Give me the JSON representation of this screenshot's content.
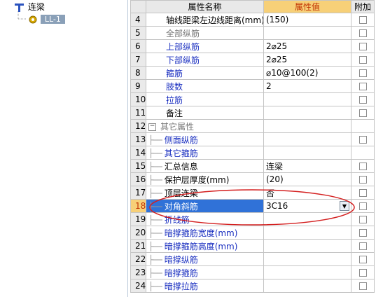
{
  "tree": {
    "root_label": "连梁",
    "child_label": "LL-1"
  },
  "grid": {
    "headers": {
      "name": "属性名称",
      "value": "属性值",
      "extra": "附加"
    },
    "rows": [
      {
        "num": "4",
        "name": "轴线距梁左边线距离(mm)",
        "value": "(150)",
        "style": "normal",
        "branch": false,
        "check": true
      },
      {
        "num": "5",
        "name": "全部纵筋",
        "value": "",
        "style": "gray",
        "branch": false,
        "check": true
      },
      {
        "num": "6",
        "name": "上部纵筋",
        "value": "2⌀25",
        "style": "blue",
        "branch": false,
        "check": true
      },
      {
        "num": "7",
        "name": "下部纵筋",
        "value": "2⌀25",
        "style": "blue",
        "branch": false,
        "check": true
      },
      {
        "num": "8",
        "name": "箍筋",
        "value": "⌀10@100(2)",
        "style": "blue",
        "branch": false,
        "check": true
      },
      {
        "num": "9",
        "name": "肢数",
        "value": "2",
        "style": "blue",
        "branch": false,
        "check": true
      },
      {
        "num": "10",
        "name": "拉筋",
        "value": "",
        "style": "blue",
        "branch": false,
        "check": true
      },
      {
        "num": "11",
        "name": "备注",
        "value": "",
        "style": "normal",
        "branch": false,
        "check": true
      },
      {
        "num": "12",
        "name": "其它属性",
        "value": "",
        "style": "group",
        "branch": false,
        "check": false
      },
      {
        "num": "13",
        "name": "侧面纵筋",
        "value": "",
        "style": "blue",
        "branch": true,
        "check": true
      },
      {
        "num": "14",
        "name": "其它箍筋",
        "value": "",
        "style": "blue",
        "branch": true,
        "check": false
      },
      {
        "num": "15",
        "name": "汇总信息",
        "value": "连梁",
        "style": "normal",
        "branch": true,
        "check": true
      },
      {
        "num": "16",
        "name": "保护层厚度(mm)",
        "value": "(20)",
        "style": "normal",
        "branch": true,
        "check": true
      },
      {
        "num": "17",
        "name": "顶层连梁",
        "value": "否",
        "style": "normal",
        "branch": true,
        "check": true
      },
      {
        "num": "18",
        "name": "对角斜筋",
        "value": "3C16",
        "style": "selected",
        "branch": true,
        "check": true
      },
      {
        "num": "19",
        "name": "折线筋",
        "value": "",
        "style": "blue",
        "branch": true,
        "check": true
      },
      {
        "num": "20",
        "name": "暗撑箍筋宽度(mm)",
        "value": "",
        "style": "blue",
        "branch": true,
        "check": true
      },
      {
        "num": "21",
        "name": "暗撑箍筋高度(mm)",
        "value": "",
        "style": "blue",
        "branch": true,
        "check": true
      },
      {
        "num": "22",
        "name": "暗撑纵筋",
        "value": "",
        "style": "blue",
        "branch": true,
        "check": true
      },
      {
        "num": "23",
        "name": "暗撑箍筋",
        "value": "",
        "style": "blue",
        "branch": true,
        "check": true
      },
      {
        "num": "24",
        "name": "暗撑拉筋",
        "value": "",
        "style": "blue",
        "branch": true,
        "check": true
      }
    ]
  },
  "colors": {
    "header_highlight": "#f7d078",
    "selected_row": "#3072d8",
    "blue_text": "#1a2fc0",
    "annotation_ellipse": "#d42020"
  }
}
